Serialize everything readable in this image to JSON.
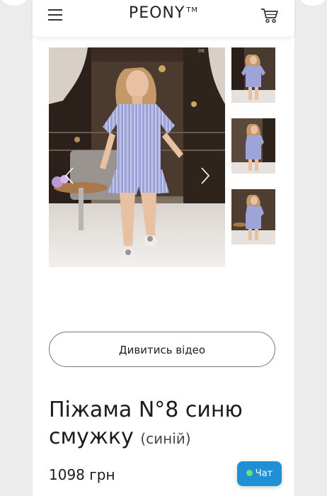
{
  "header": {
    "logo": "PEONY",
    "trademark": "TM"
  },
  "gallery": {
    "counter": "06"
  },
  "actions": {
    "video_label": "Дивитись відео"
  },
  "product": {
    "title": "Піжама N°8 синю смужку",
    "color": "(синій)",
    "price": "1098 грн"
  },
  "chat": {
    "label": "Чат"
  },
  "colors": {
    "accent": "#1f8fd6",
    "online": "#6ee27a"
  }
}
